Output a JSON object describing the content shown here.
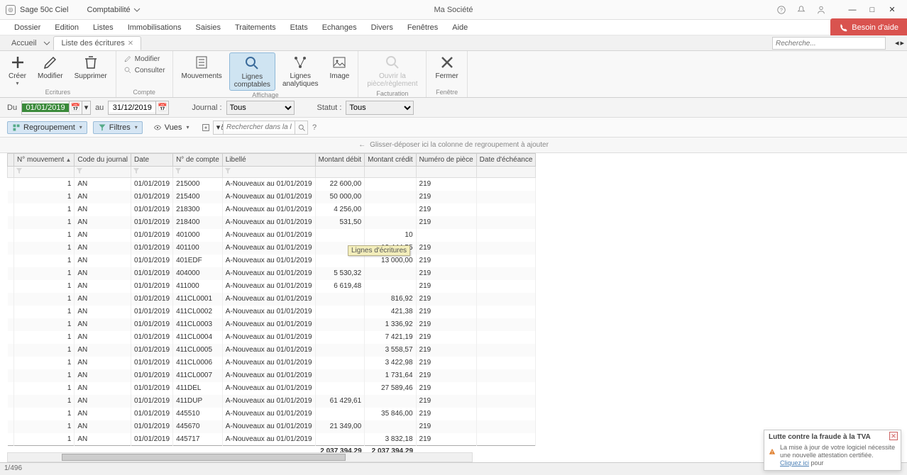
{
  "titlebar": {
    "appname": "Sage 50c Ciel",
    "module": "Comptabilité",
    "company": "Ma Société"
  },
  "menubar": {
    "items": [
      "Dossier",
      "Edition",
      "Listes",
      "Immobilisations",
      "Saisies",
      "Traitements",
      "Etats",
      "Echanges",
      "Divers",
      "Fenêtres",
      "Aide"
    ],
    "help_button": "Besoin d'aide"
  },
  "tabbar": {
    "home": "Accueil",
    "active": "Liste des écritures",
    "search_placeholder": "Recherche..."
  },
  "ribbon": {
    "ecritures": {
      "label": "Ecritures",
      "creer": "Créer",
      "modifier": "Modifier",
      "supprimer": "Supprimer"
    },
    "compte": {
      "label": "Compte",
      "modifier": "Modifier",
      "consulter": "Consulter"
    },
    "affichage": {
      "label": "Affichage",
      "mouvements": "Mouvements",
      "lignes_comptables": "Lignes\ncomptables",
      "lignes_analytiques": "Lignes\nanalytiques",
      "image": "Image"
    },
    "facturation": {
      "label": "Facturation",
      "ouvrir": "Ouvrir la\npièce/règlement"
    },
    "fenetre": {
      "label": "Fenêtre",
      "fermer": "Fermer"
    }
  },
  "filterbar": {
    "du": "Du",
    "au": "au",
    "date_from": "01/01/2019",
    "date_to": "31/12/2019",
    "journal_label": "Journal :",
    "journal_value": "Tous",
    "statut_label": "Statut :",
    "statut_value": "Tous"
  },
  "toolbar2": {
    "regroupement": "Regroupement",
    "filtres": "Filtres",
    "vues": "Vues",
    "search_placeholder": "Rechercher dans la liste",
    "help": "?"
  },
  "groupdrop": "Glisser-déposer ici la colonne de regroupement à ajouter",
  "table": {
    "columns": [
      "N° mouvement",
      "Code du journal",
      "Date",
      "N° de compte",
      "Libellé",
      "Montant débit",
      "Montant crédit",
      "Numéro de pièce",
      "Date d'échéance"
    ],
    "rows": [
      {
        "mvt": "1",
        "journal": "AN",
        "date": "01/01/2019",
        "compte": "215000",
        "libelle": "A-Nouveaux au 01/01/2019",
        "debit": "22 600,00",
        "credit": "",
        "piece": "219",
        "echeance": ""
      },
      {
        "mvt": "1",
        "journal": "AN",
        "date": "01/01/2019",
        "compte": "215400",
        "libelle": "A-Nouveaux au 01/01/2019",
        "debit": "50 000,00",
        "credit": "",
        "piece": "219",
        "echeance": ""
      },
      {
        "mvt": "1",
        "journal": "AN",
        "date": "01/01/2019",
        "compte": "218300",
        "libelle": "A-Nouveaux au 01/01/2019",
        "debit": "4 256,00",
        "credit": "",
        "piece": "219",
        "echeance": ""
      },
      {
        "mvt": "1",
        "journal": "AN",
        "date": "01/01/2019",
        "compte": "218400",
        "libelle": "A-Nouveaux au 01/01/2019",
        "debit": "531,50",
        "credit": "",
        "piece": "219",
        "echeance": ""
      },
      {
        "mvt": "1",
        "journal": "AN",
        "date": "01/01/2019",
        "compte": "401000",
        "libelle": "A-Nouveaux au 01/01/2019",
        "debit": "",
        "credit": "10",
        "piece": "",
        "echeance": ""
      },
      {
        "mvt": "1",
        "journal": "AN",
        "date": "01/01/2019",
        "compte": "401100",
        "libelle": "A-Nouveaux au 01/01/2019",
        "debit": "",
        "credit": "19 444,55",
        "piece": "219",
        "echeance": ""
      },
      {
        "mvt": "1",
        "journal": "AN",
        "date": "01/01/2019",
        "compte": "401EDF",
        "libelle": "A-Nouveaux au 01/01/2019",
        "debit": "",
        "credit": "13 000,00",
        "piece": "219",
        "echeance": ""
      },
      {
        "mvt": "1",
        "journal": "AN",
        "date": "01/01/2019",
        "compte": "404000",
        "libelle": "A-Nouveaux au 01/01/2019",
        "debit": "5 530,32",
        "credit": "",
        "piece": "219",
        "echeance": ""
      },
      {
        "mvt": "1",
        "journal": "AN",
        "date": "01/01/2019",
        "compte": "411000",
        "libelle": "A-Nouveaux au 01/01/2019",
        "debit": "6 619,48",
        "credit": "",
        "piece": "219",
        "echeance": ""
      },
      {
        "mvt": "1",
        "journal": "AN",
        "date": "01/01/2019",
        "compte": "411CL0001",
        "libelle": "A-Nouveaux au 01/01/2019",
        "debit": "",
        "credit": "816,92",
        "piece": "219",
        "echeance": ""
      },
      {
        "mvt": "1",
        "journal": "AN",
        "date": "01/01/2019",
        "compte": "411CL0002",
        "libelle": "A-Nouveaux au 01/01/2019",
        "debit": "",
        "credit": "421,38",
        "piece": "219",
        "echeance": ""
      },
      {
        "mvt": "1",
        "journal": "AN",
        "date": "01/01/2019",
        "compte": "411CL0003",
        "libelle": "A-Nouveaux au 01/01/2019",
        "debit": "",
        "credit": "1 336,92",
        "piece": "219",
        "echeance": ""
      },
      {
        "mvt": "1",
        "journal": "AN",
        "date": "01/01/2019",
        "compte": "411CL0004",
        "libelle": "A-Nouveaux au 01/01/2019",
        "debit": "",
        "credit": "7 421,19",
        "piece": "219",
        "echeance": ""
      },
      {
        "mvt": "1",
        "journal": "AN",
        "date": "01/01/2019",
        "compte": "411CL0005",
        "libelle": "A-Nouveaux au 01/01/2019",
        "debit": "",
        "credit": "3 558,57",
        "piece": "219",
        "echeance": ""
      },
      {
        "mvt": "1",
        "journal": "AN",
        "date": "01/01/2019",
        "compte": "411CL0006",
        "libelle": "A-Nouveaux au 01/01/2019",
        "debit": "",
        "credit": "3 422,98",
        "piece": "219",
        "echeance": ""
      },
      {
        "mvt": "1",
        "journal": "AN",
        "date": "01/01/2019",
        "compte": "411CL0007",
        "libelle": "A-Nouveaux au 01/01/2019",
        "debit": "",
        "credit": "1 731,64",
        "piece": "219",
        "echeance": ""
      },
      {
        "mvt": "1",
        "journal": "AN",
        "date": "01/01/2019",
        "compte": "411DEL",
        "libelle": "A-Nouveaux au 01/01/2019",
        "debit": "",
        "credit": "27 589,46",
        "piece": "219",
        "echeance": ""
      },
      {
        "mvt": "1",
        "journal": "AN",
        "date": "01/01/2019",
        "compte": "411DUP",
        "libelle": "A-Nouveaux au 01/01/2019",
        "debit": "61 429,61",
        "credit": "",
        "piece": "219",
        "echeance": ""
      },
      {
        "mvt": "1",
        "journal": "AN",
        "date": "01/01/2019",
        "compte": "445510",
        "libelle": "A-Nouveaux au 01/01/2019",
        "debit": "",
        "credit": "35 846,00",
        "piece": "219",
        "echeance": ""
      },
      {
        "mvt": "1",
        "journal": "AN",
        "date": "01/01/2019",
        "compte": "445670",
        "libelle": "A-Nouveaux au 01/01/2019",
        "debit": "21 349,00",
        "credit": "",
        "piece": "219",
        "echeance": ""
      },
      {
        "mvt": "1",
        "journal": "AN",
        "date": "01/01/2019",
        "compte": "445717",
        "libelle": "A-Nouveaux au 01/01/2019",
        "debit": "",
        "credit": "3 832,18",
        "piece": "219",
        "echeance": ""
      }
    ],
    "totals": {
      "debit": "2 037 394,29",
      "credit": "2 037 394,29"
    }
  },
  "tooltip": "Lignes d'écritures",
  "statusbar": "1/496",
  "notify": {
    "title": "Lutte contre la fraude à la TVA",
    "text_prefix": "La mise à jour de votre logiciel nécessite une nouvelle attestation certifiée. ",
    "link": "Cliquez ici",
    "text_suffix": " pour"
  }
}
